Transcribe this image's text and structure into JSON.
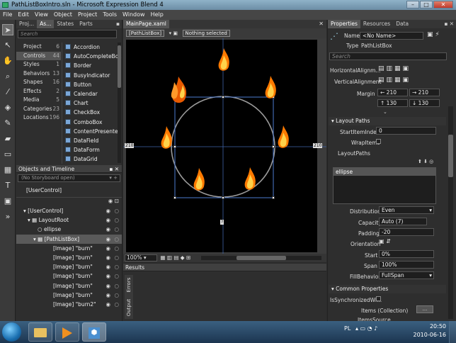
{
  "window": {
    "title": "PathListBoxIntro.sln - Microsoft Expression Blend 4",
    "min": "–",
    "max": "□",
    "close": "✕"
  },
  "menu": [
    "File",
    "Edit",
    "View",
    "Object",
    "Project",
    "Tools",
    "Window",
    "Help"
  ],
  "left_tabs": [
    "Proj...",
    "As...",
    "States",
    "Parts"
  ],
  "search_placeholder": "Search",
  "asset_categories": [
    {
      "label": "Project",
      "count": "6"
    },
    {
      "label": "Controls",
      "count": "44"
    },
    {
      "label": "Styles",
      "count": "1"
    },
    {
      "label": "Behaviors",
      "count": "13"
    },
    {
      "label": "Shapes",
      "count": "16"
    },
    {
      "label": "Effects",
      "count": "2"
    },
    {
      "label": "Media",
      "count": "5"
    },
    {
      "label": "Categories",
      "count": "23"
    },
    {
      "label": "Locations",
      "count": "196"
    }
  ],
  "asset_items": [
    "Accordion",
    "AutoCompleteBox",
    "Border",
    "BusyIndicator",
    "Button",
    "Calendar",
    "Chart",
    "CheckBox",
    "ComboBox",
    "ContentPresenter",
    "DataField",
    "DataForm",
    "DataGrid"
  ],
  "objects_panel": {
    "title": "Objects and Timeline",
    "storyboard": "(No Storyboard open)",
    "scope": "[UserControl]"
  },
  "tree": [
    {
      "label": "[UserControl]",
      "indent": 10
    },
    {
      "label": "LayoutRoot",
      "indent": 18
    },
    {
      "label": "ellipse",
      "indent": 26
    },
    {
      "label": "[PathListBox]",
      "indent": 26
    },
    {
      "label": "[Image] \"burn\"",
      "indent": 34
    },
    {
      "label": "[Image] \"burn\"",
      "indent": 34
    },
    {
      "label": "[Image] \"burn\"",
      "indent": 34
    },
    {
      "label": "[Image] \"burn\"",
      "indent": 34
    },
    {
      "label": "[Image] \"burn\"",
      "indent": 34
    },
    {
      "label": "[Image] \"burn\"",
      "indent": 34
    },
    {
      "label": "[Image] \"burn2\"",
      "indent": 34
    }
  ],
  "document": {
    "tab": "MainPage.xaml",
    "breadcrumb": "[PathListBox]",
    "selection": "Nothing selected",
    "zoom": "100%",
    "dim_left": "210",
    "dim_right": "210",
    "dim_top": "?",
    "dim_bottom": "?"
  },
  "results": {
    "title": "Results",
    "tabs": [
      "Errors",
      "Output"
    ]
  },
  "properties": {
    "tabs": [
      "Properties",
      "Resources",
      "Data"
    ],
    "name_label": "Name",
    "name_value": "<No Name>",
    "type_label": "Type",
    "type_value": "PathListBox",
    "search_placeholder": "Search",
    "h_align": "HorizontalAlignm...",
    "v_align": "VerticalAlignment",
    "margin_label": "Margin",
    "margin_values": [
      "210",
      "210",
      "130",
      "130"
    ],
    "layout_paths_title": "Layout Paths",
    "start_item_index_label": "StartItemIndex",
    "start_item_index": "0",
    "wrap_items_label": "WrapItems",
    "layout_paths_label": "LayoutPaths",
    "path_item": "ellipse",
    "distribution_label": "Distribution",
    "distribution": "Even",
    "capacity_label": "Capacity",
    "capacity": "Auto (7)",
    "padding_label": "Padding",
    "padding": "-20",
    "orientation_label": "Orientation",
    "start_label": "Start",
    "start": "0%",
    "span_label": "Span",
    "span": "100%",
    "fill_behavior_label": "FillBehavior",
    "fill_behavior": "FullSpan",
    "common_title": "Common Properties",
    "is_sync_label": "IsSynchronizedWi...",
    "items_label": "Items (Collection)",
    "items_btn": "...",
    "items_source_label": "ItemsSource"
  },
  "tray": {
    "lang": "PL",
    "time": "20:50",
    "date": "2010-06-16"
  },
  "colors": {
    "accent": "#6c8da5",
    "canvas": "#000000",
    "panel": "#2b2b2b"
  }
}
